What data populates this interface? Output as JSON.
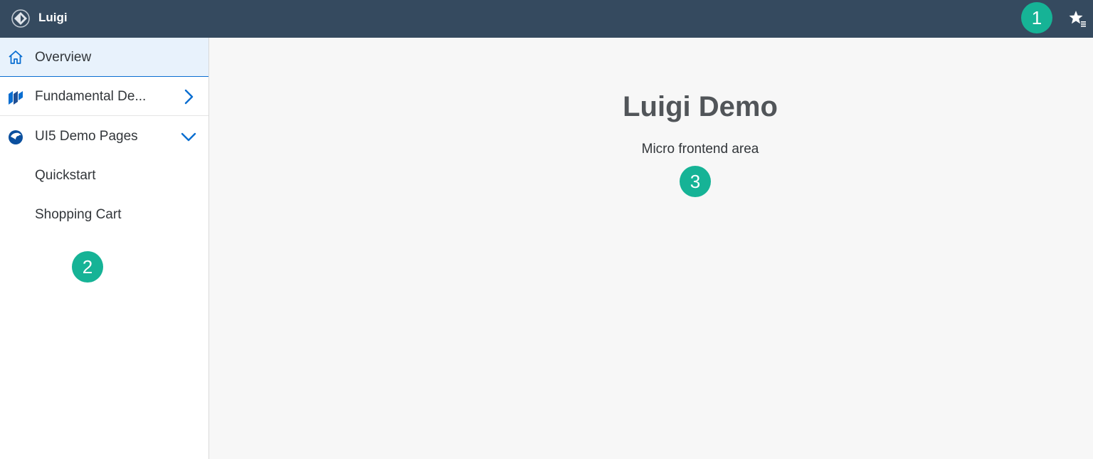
{
  "shellbar": {
    "title": "Luigi",
    "logo_icon": "luigi-logo-icon",
    "action_icon": "favorites-star-icon"
  },
  "sidebar": {
    "items": [
      {
        "label": "Overview",
        "icon": "home-icon",
        "selected": true
      },
      {
        "label": "Fundamental De...",
        "icon": "fundamental-icon",
        "chevron": "right"
      },
      {
        "label": "UI5 Demo Pages",
        "icon": "ui5-icon",
        "chevron": "down"
      },
      {
        "label": "Quickstart"
      },
      {
        "label": "Shopping Cart"
      }
    ]
  },
  "content": {
    "title": "Luigi Demo",
    "subtitle": "Micro frontend area"
  },
  "annotations": {
    "badge_1": "1",
    "badge_2": "2",
    "badge_3": "3",
    "color": "#16b396"
  },
  "colors": {
    "shellbar": "#354a5f",
    "selected_bg": "#e8f2fc",
    "accent": "#0a6ed1",
    "text": "#32363a"
  }
}
